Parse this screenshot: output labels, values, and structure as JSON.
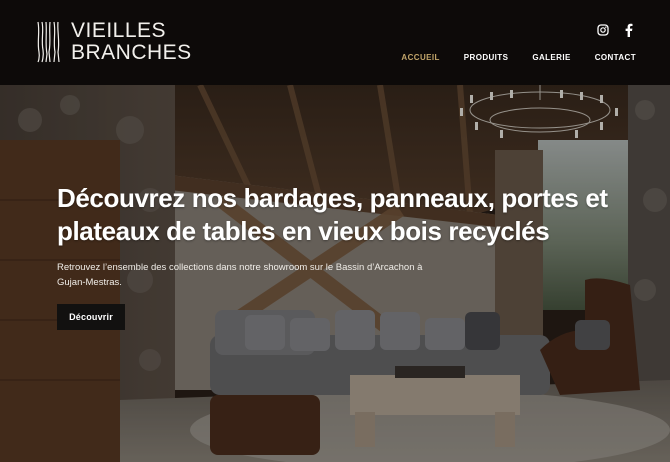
{
  "brand": {
    "line1": "VIEILLES",
    "line2": "BRANCHES"
  },
  "social": {
    "instagram_icon": "instagram-icon",
    "facebook_icon": "facebook-icon"
  },
  "nav": {
    "items": [
      {
        "label": "ACCUEIL",
        "active": true
      },
      {
        "label": "PRODUITS",
        "active": false
      },
      {
        "label": "GALERIE",
        "active": false
      },
      {
        "label": "CONTACT",
        "active": false
      }
    ]
  },
  "hero": {
    "title": "Découvrez nos bardages, panneaux, portes et plateaux de tables en vieux bois recyclés",
    "subtitle": "Retrouvez l’ensemble des collections dans notre showroom sur le Bassin d’Arcachon à Gujan-Mestras.",
    "cta_label": "Découvrir"
  },
  "colors": {
    "accent": "#c2a56a",
    "header_bg": "#0c0a09",
    "button_bg": "#121110",
    "text": "#ffffff"
  }
}
